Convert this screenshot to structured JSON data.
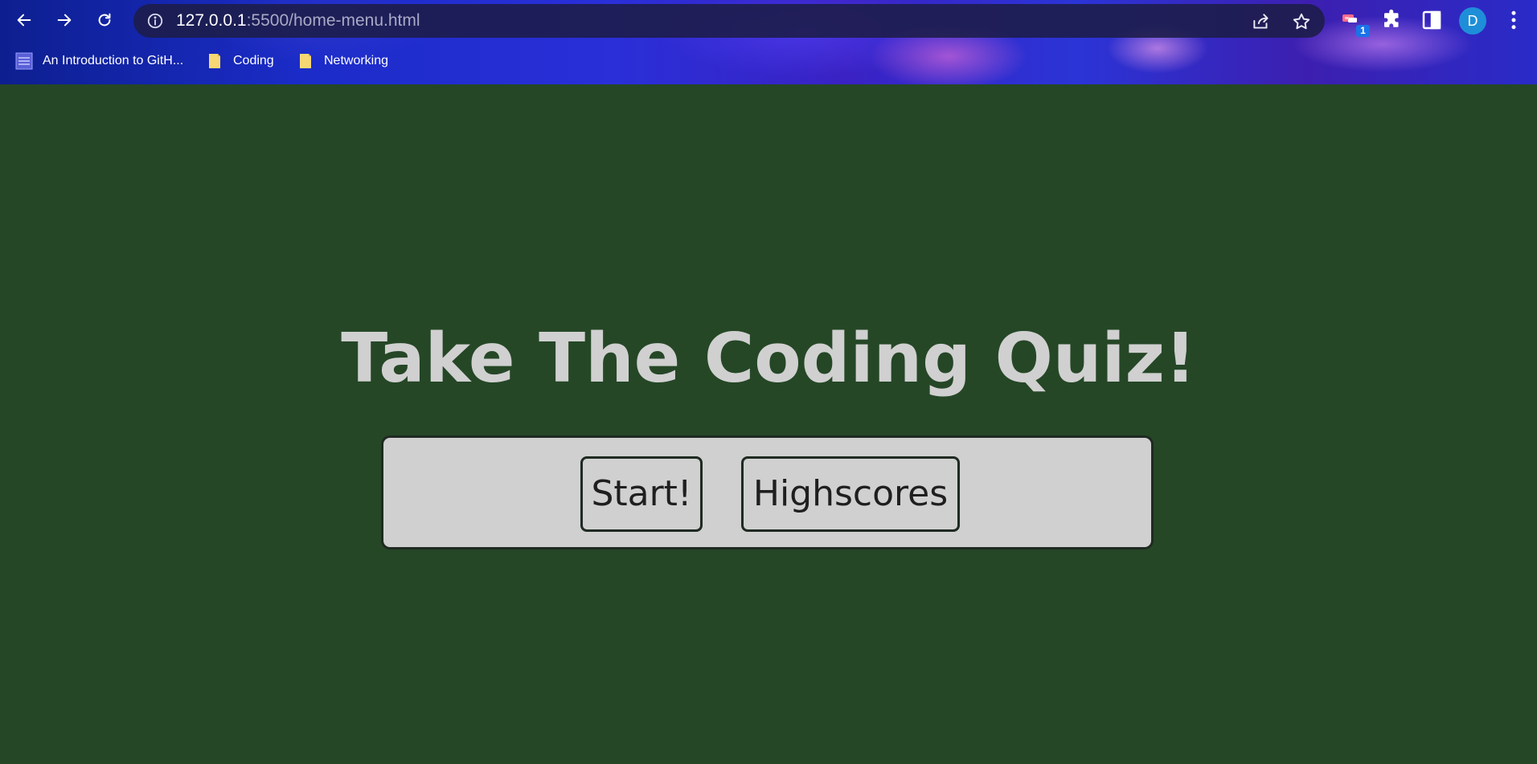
{
  "browser": {
    "url_host": "127.0.0.1",
    "url_path": ":5500/home-menu.html",
    "extension_badge": "1",
    "profile_initial": "D",
    "bookmarks": [
      {
        "label": "An Introduction to GitH...",
        "icon": "github-learning-icon"
      },
      {
        "label": "Coding",
        "icon": "folder-icon"
      },
      {
        "label": "Networking",
        "icon": "folder-icon"
      }
    ],
    "colors": {
      "page_background": "#254726",
      "panel_background": "#d0d0d0",
      "title_text": "#d0d0d0",
      "border": "#1f2a22",
      "profile_avatar": "#1f8ed8"
    }
  },
  "page": {
    "title": "Take The Coding Quiz!",
    "buttons": {
      "start_label": "Start!",
      "highscores_label": "Highscores"
    }
  }
}
